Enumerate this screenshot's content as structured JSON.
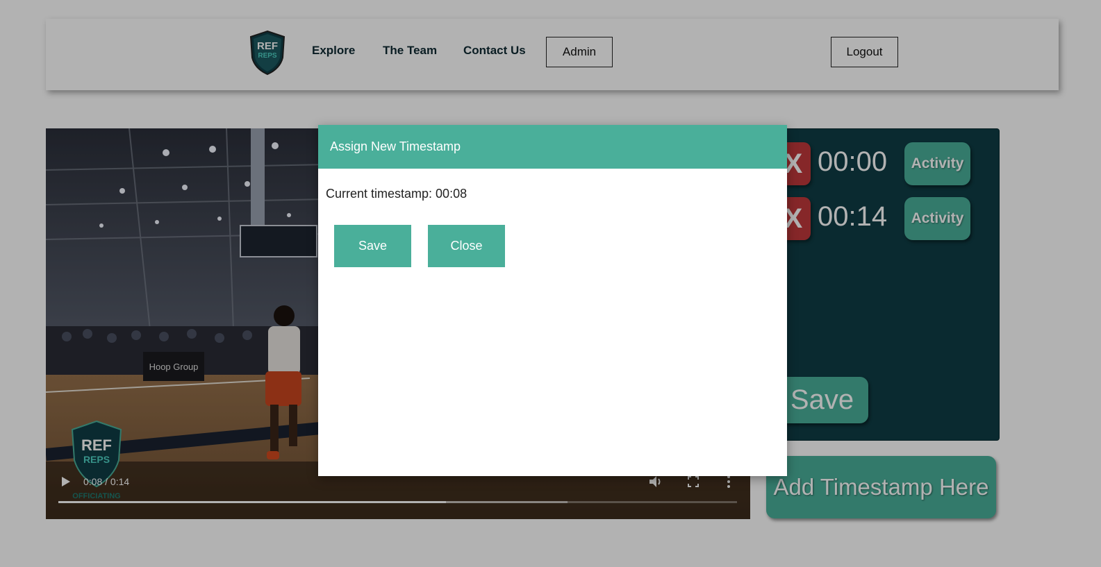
{
  "header": {
    "logo_text_top": "REF",
    "logo_text_bottom": "REPS",
    "nav": [
      "Explore",
      "The Team",
      "Contact Us"
    ],
    "admin_label": "Admin",
    "logout_label": "Logout"
  },
  "video": {
    "time_display": "0:08 / 0:14",
    "progress_fraction": 0.5714,
    "banner_text": "Hoop Group",
    "watermark_top": "REF",
    "watermark_bottom": "REPS",
    "watermark_caption": "OFFICIATING"
  },
  "timestamps": {
    "delete_label": "X",
    "activity_label": "Activity",
    "items": [
      {
        "time": "00:00"
      },
      {
        "time": "00:14"
      }
    ],
    "save_label": "Save",
    "add_label": "Add Timestamp Here"
  },
  "modal": {
    "title": "Assign New Timestamp",
    "current_text": "Current timestamp: 00:08",
    "save_label": "Save",
    "close_label": "Close"
  },
  "colors": {
    "accent": "#4aaf9a",
    "panel": "#0f3d45",
    "danger": "#c0393b"
  }
}
